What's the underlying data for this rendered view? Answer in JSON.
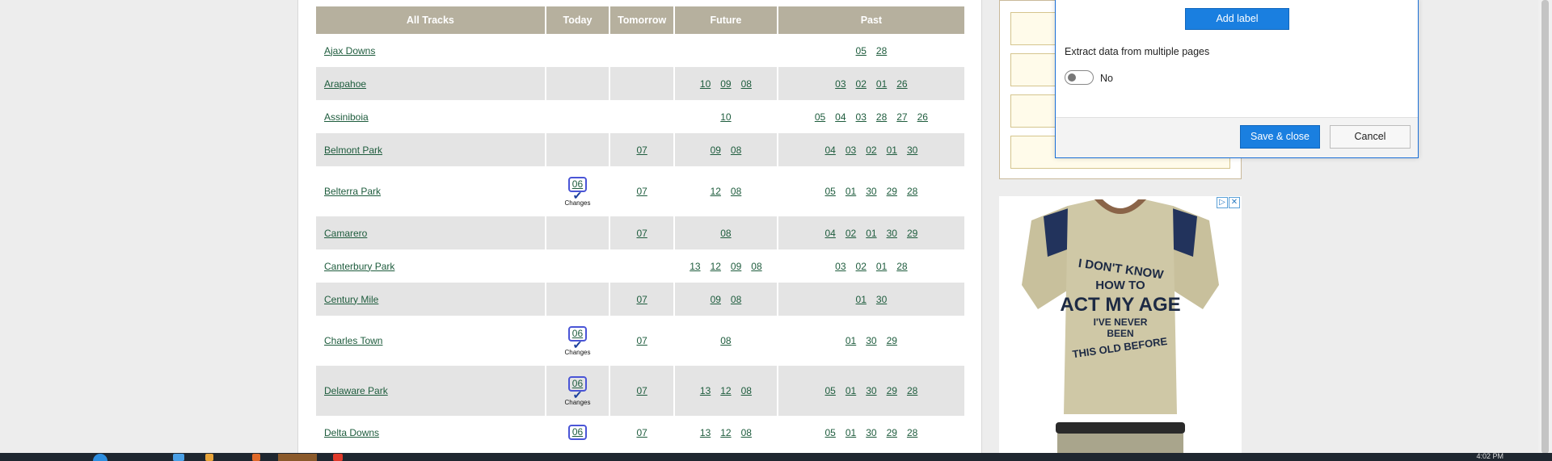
{
  "table": {
    "headers": [
      "All Tracks",
      "Today",
      "Tomorrow",
      "Future",
      "Past"
    ],
    "rows": [
      {
        "name": "Ajax Downs",
        "today": "",
        "changes": false,
        "tomorrow": "",
        "future": [],
        "past": [
          "05",
          "28"
        ]
      },
      {
        "name": "Arapahoe",
        "today": "",
        "changes": false,
        "tomorrow": "",
        "future": [
          "10",
          "09",
          "08"
        ],
        "past": [
          "03",
          "02",
          "01",
          "26"
        ]
      },
      {
        "name": "Assiniboia",
        "today": "",
        "changes": false,
        "tomorrow": "",
        "future": [
          "10"
        ],
        "past": [
          "05",
          "04",
          "03",
          "28",
          "27",
          "26"
        ]
      },
      {
        "name": "Belmont Park",
        "today": "",
        "changes": false,
        "tomorrow": "07",
        "future": [
          "09",
          "08"
        ],
        "past": [
          "04",
          "03",
          "02",
          "01",
          "30"
        ]
      },
      {
        "name": "Belterra Park",
        "today": "06",
        "changes": true,
        "tomorrow": "07",
        "future": [
          "12",
          "08"
        ],
        "past": [
          "05",
          "01",
          "30",
          "29",
          "28"
        ]
      },
      {
        "name": "Camarero",
        "today": "",
        "changes": false,
        "tomorrow": "07",
        "future": [
          "08"
        ],
        "past": [
          "04",
          "02",
          "01",
          "30",
          "29"
        ]
      },
      {
        "name": "Canterbury Park",
        "today": "",
        "changes": false,
        "tomorrow": "",
        "future": [
          "13",
          "12",
          "09",
          "08"
        ],
        "past": [
          "03",
          "02",
          "01",
          "28"
        ]
      },
      {
        "name": "Century Mile",
        "today": "",
        "changes": false,
        "tomorrow": "07",
        "future": [
          "09",
          "08"
        ],
        "past": [
          "01",
          "30"
        ]
      },
      {
        "name": "Charles Town",
        "today": "06",
        "changes": true,
        "tomorrow": "07",
        "future": [
          "08"
        ],
        "past": [
          "01",
          "30",
          "29"
        ]
      },
      {
        "name": "Delaware Park",
        "today": "06",
        "changes": true,
        "tomorrow": "07",
        "future": [
          "13",
          "12",
          "08"
        ],
        "past": [
          "05",
          "01",
          "30",
          "29",
          "28"
        ]
      },
      {
        "name": "Delta Downs",
        "today": "06",
        "changes": false,
        "tomorrow": "07",
        "future": [
          "13",
          "12",
          "08"
        ],
        "past": [
          "05",
          "01",
          "30",
          "29",
          "28"
        ]
      }
    ],
    "changes_label": "Changes"
  },
  "dialog": {
    "add_label": "Add label",
    "extract_label": "Extract data from multiple pages",
    "toggle_state": "No",
    "save_label": "Save & close",
    "cancel_label": "Cancel"
  },
  "ad": {
    "shirt_text": "I DON'T KNOW HOW TO ACT MY AGE I'VE NEVER BEEN THIS OLD BEFORE",
    "adchoices_icon": "adchoices-icon",
    "close_icon": "close-icon"
  },
  "taskbar": {
    "time": "4:02 PM"
  }
}
